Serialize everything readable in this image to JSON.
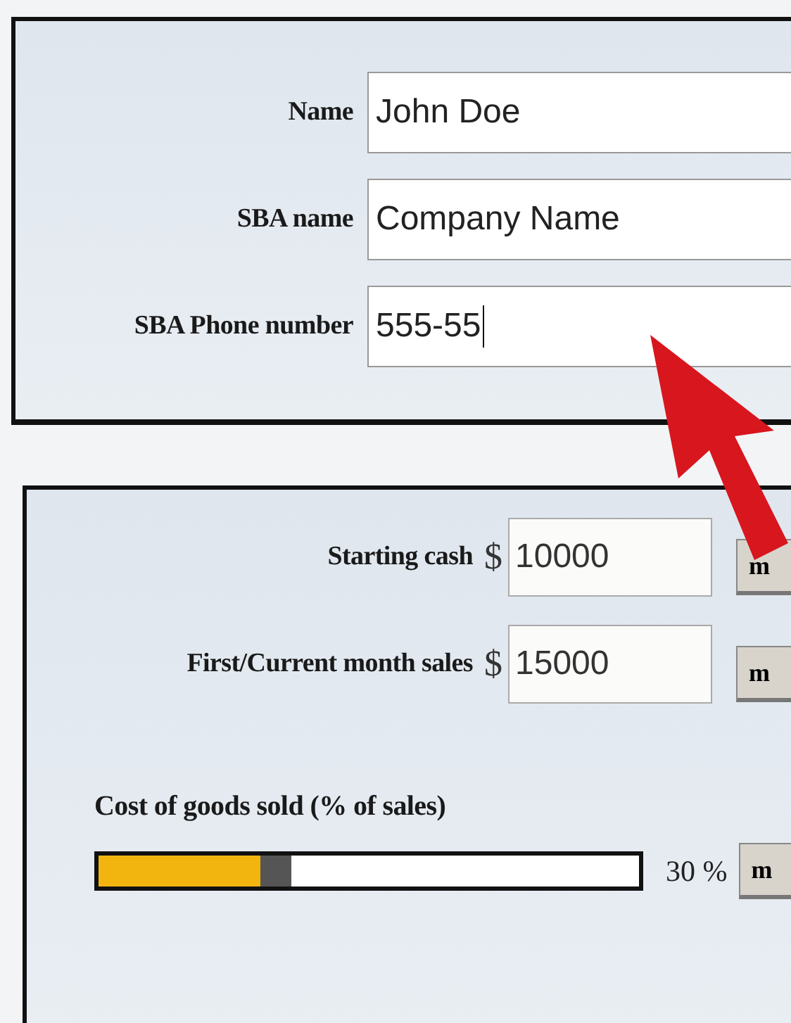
{
  "contact_form": {
    "fields": [
      {
        "label": "Name",
        "value": "John Doe"
      },
      {
        "label": "SBA name",
        "value": "Company Name"
      },
      {
        "label": "SBA Phone number",
        "value": "555-55",
        "focused": true
      }
    ]
  },
  "finance_form": {
    "fields": [
      {
        "label": "Starting cash",
        "currency": "$",
        "value": "10000",
        "button": "m"
      },
      {
        "label": "First/Current month sales",
        "currency": "$",
        "value": "15000",
        "button": "m"
      }
    ],
    "slider": {
      "label": "Cost of goods sold (% of sales)",
      "level": 0.3,
      "reading": "30 %",
      "button": "m"
    }
  },
  "pointer": {
    "kind": "arrow"
  }
}
